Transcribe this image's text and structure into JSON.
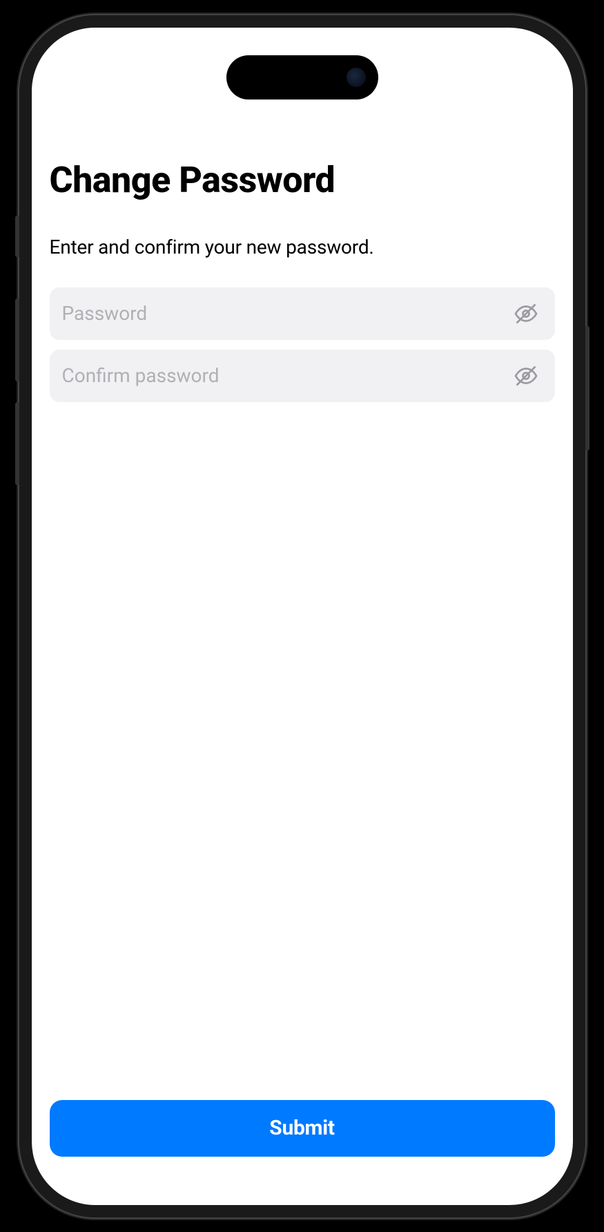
{
  "header": {
    "title": "Change Password",
    "subtitle": "Enter and confirm your new password."
  },
  "form": {
    "password": {
      "placeholder": "Password",
      "value": ""
    },
    "confirm_password": {
      "placeholder": "Confirm password",
      "value": ""
    }
  },
  "actions": {
    "submit_label": "Submit"
  },
  "icons": {
    "toggle_visibility": "eye-off-icon"
  },
  "colors": {
    "primary": "#007aff",
    "input_bg": "#f1f1f3",
    "placeholder": "#b0b0b5"
  }
}
